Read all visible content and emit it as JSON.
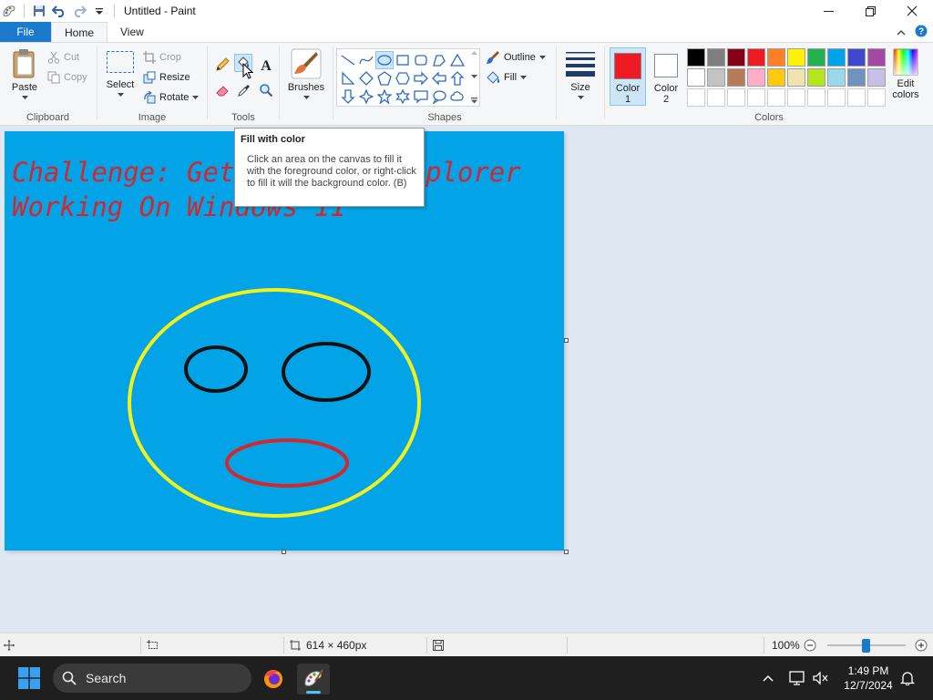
{
  "window": {
    "title": "Untitled - Paint"
  },
  "menu": {
    "file": "File",
    "home": "Home",
    "view": "View"
  },
  "clipboard": {
    "paste": "Paste",
    "cut": "Cut",
    "copy": "Copy",
    "label": "Clipboard"
  },
  "image": {
    "select": "Select",
    "crop": "Crop",
    "resize": "Resize",
    "rotate": "Rotate",
    "label": "Image"
  },
  "tools": {
    "label": "Tools"
  },
  "brushes": {
    "label": "Brushes"
  },
  "shapes": {
    "outline": "Outline",
    "fill": "Fill",
    "label": "Shapes"
  },
  "size": {
    "label": "Size"
  },
  "colors": {
    "color1_label1": "Color",
    "color1_label2": "1",
    "color2_label1": "Color",
    "color2_label2": "2",
    "edit_label1": "Edit",
    "edit_label2": "colors",
    "label": "Colors",
    "color1": "#ed1c24",
    "color2": "#ffffff",
    "palette": [
      "#000000",
      "#7f7f7f",
      "#880015",
      "#ed1c24",
      "#ff7f27",
      "#fff200",
      "#22b14c",
      "#00a2e8",
      "#3f48cc",
      "#a349a4",
      "#ffffff",
      "#c3c3c3",
      "#b97a57",
      "#ffaec9",
      "#ffc90e",
      "#efe4b0",
      "#b5e61d",
      "#99d9ea",
      "#7092be",
      "#c8bfe7",
      "#ffffff",
      "#ffffff",
      "#ffffff",
      "#ffffff",
      "#ffffff",
      "#ffffff",
      "#ffffff",
      "#ffffff",
      "#ffffff",
      "#ffffff"
    ]
  },
  "tooltip": {
    "title": "Fill with color",
    "body": "Click an area on the canvas to fill it with the foreground color, or right-click to fill it will the background color. (B)"
  },
  "canvas": {
    "background": "#03a3e8",
    "text_line1": "Challenge: Get Internet Explorer",
    "text_line2": "Working On Windows 11"
  },
  "status": {
    "dimensions": "614 × 460px",
    "zoom": "100%"
  },
  "taskbar": {
    "search": "Search",
    "time": "1:49 PM",
    "date": "12/7/2024"
  }
}
